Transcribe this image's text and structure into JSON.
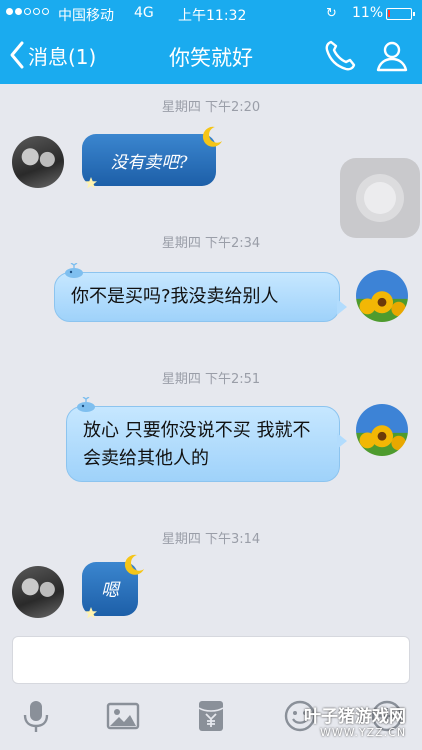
{
  "status_bar": {
    "carrier": "中国移动",
    "network": "4G",
    "time": "上午11:32",
    "battery_percent": "11%",
    "battery_level": 0.11
  },
  "nav": {
    "back_label": "消息(1)",
    "title": "你笑就好",
    "icons": [
      "chevron-left-icon",
      "phone-icon",
      "profile-icon"
    ]
  },
  "messages": [
    {
      "timestamp": "星期四 下午2:20",
      "sender": "friend",
      "text": "没有卖吧?"
    },
    {
      "timestamp": "星期四 下午2:34",
      "sender": "me",
      "text": "你不是买吗?我没卖给别人"
    },
    {
      "timestamp": "星期四 下午2:51",
      "sender": "me",
      "text": "放心 只要你没说不买 我就不会卖给其他人的"
    },
    {
      "timestamp": "星期四 下午3:14",
      "sender": "friend",
      "text": "嗯"
    }
  ],
  "input": {
    "placeholder": ""
  },
  "toolbar": {
    "icons": [
      "microphone-icon",
      "image-icon",
      "red-packet-icon",
      "emoji-icon",
      "plus-icon"
    ]
  },
  "watermark": {
    "line1": "叶子猪游戏网",
    "line2": "WWW.YZZ.CN"
  },
  "colors": {
    "nav_blue": "#1aabef",
    "background": "#e6e8ee",
    "bubble_light": "#b2dcfd",
    "bubble_dark": "#2b72bd"
  }
}
